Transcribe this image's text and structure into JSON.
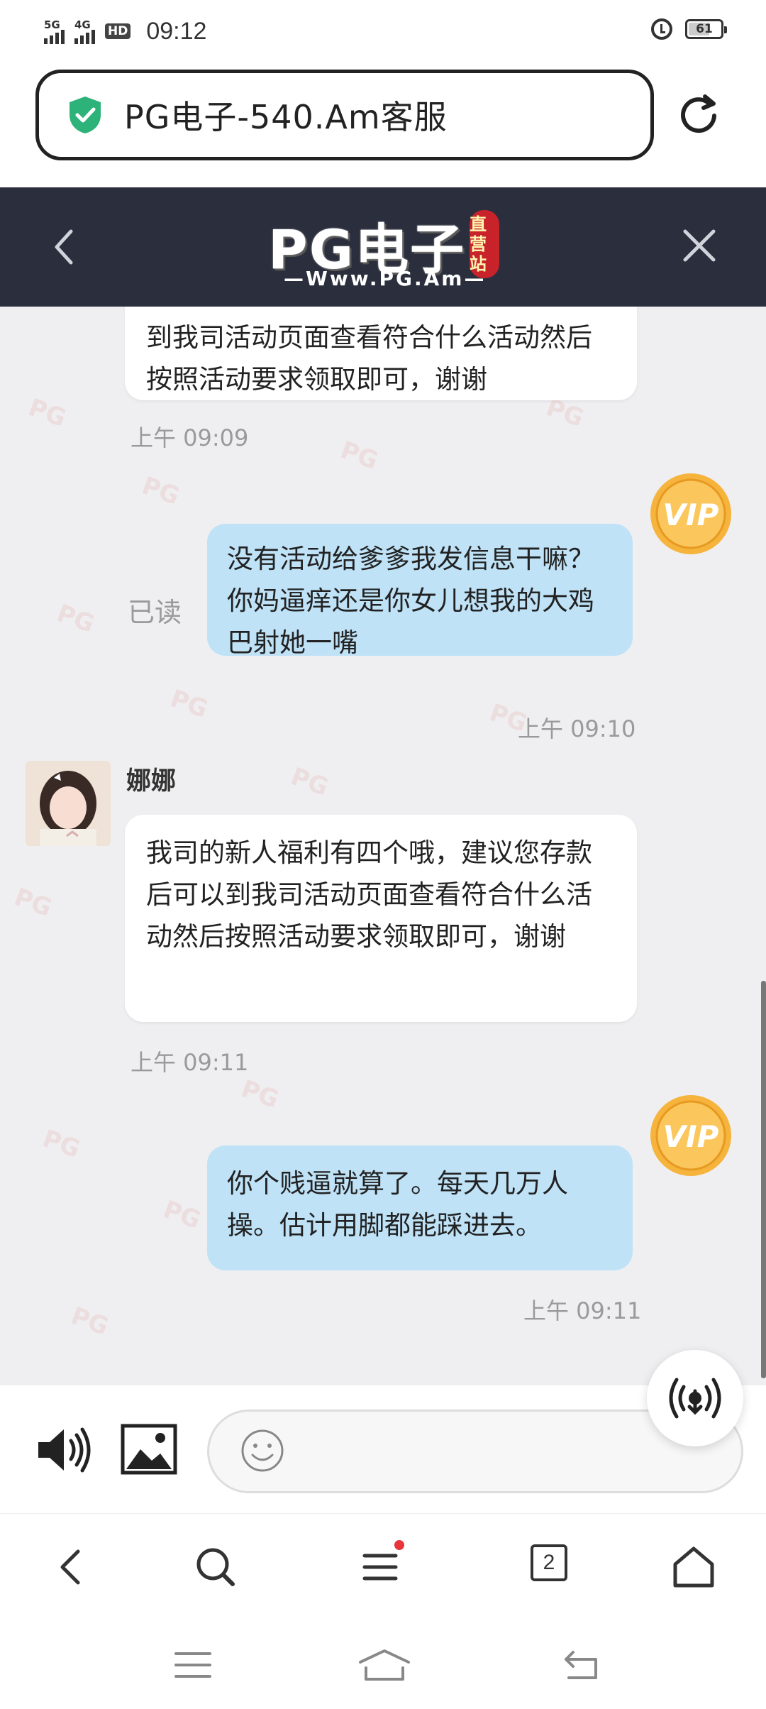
{
  "status_bar": {
    "network_1": "5G",
    "network_2": "4G",
    "hd": "HD",
    "time": "09:12",
    "battery": "61"
  },
  "address_bar": {
    "title": "PG电子-540.Am客服",
    "secure_icon": "shield-check-icon",
    "refresh_icon": "refresh-icon"
  },
  "site_header": {
    "logo_main": "PG电子",
    "logo_sub": "—Www.PG.Am—",
    "logo_badge": "直营站",
    "back_icon": "chevron-left-icon",
    "close_icon": "close-icon"
  },
  "watermark": "PG",
  "chat": {
    "messages": [
      {
        "side": "in",
        "text": "到我司活动页面查看符合什么活动然后按照活动要求领取即可，谢谢",
        "time": "上午 09:09"
      },
      {
        "side": "out",
        "text": "没有活动给爹爹我发信息干嘛？你妈逼痒还是你女儿想我的大鸡巴射她一嘴",
        "status": "已读",
        "time": "上午 09:10"
      },
      {
        "side": "in",
        "sender": "娜娜",
        "text": "我司的新人福利有四个哦，建议您存款后可以到我司活动页面查看符合什么活动然后按照活动要求领取即可，谢谢",
        "time": "上午 09:11"
      },
      {
        "side": "out",
        "text": "你个贱逼就算了。每天几万人操。估计用脚都能踩进去。",
        "time": "上午 09:11"
      }
    ],
    "vip_label": "VIP"
  },
  "input": {
    "placeholder": "",
    "speaker_icon": "speaker-icon",
    "image_icon": "image-icon",
    "emoji_icon": "emoji-icon",
    "voice_icon": "voice-wave-icon"
  },
  "toolbar": {
    "tab_count": "2"
  }
}
